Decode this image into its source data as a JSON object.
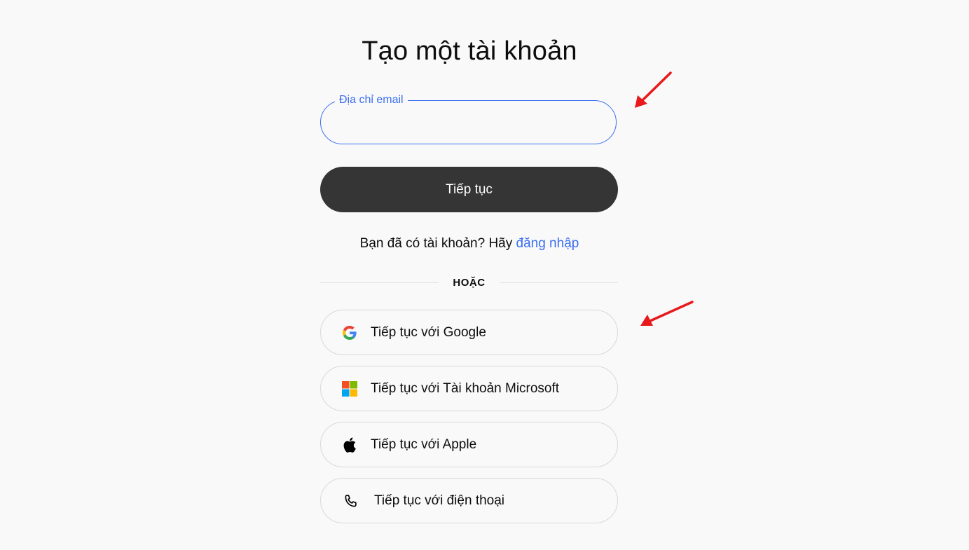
{
  "page": {
    "title": "Tạo một tài khoản"
  },
  "email": {
    "label": "Địa chỉ email",
    "value": ""
  },
  "continue_button": {
    "label": "Tiếp tục"
  },
  "login": {
    "prompt": "Bạn đã có tài khoản? Hãy ",
    "link": "đăng nhập"
  },
  "divider": {
    "text": "HOẶC"
  },
  "social": [
    {
      "label": "Tiếp tục với Google",
      "icon": "google-icon"
    },
    {
      "label": "Tiếp tục với Tài khoản Microsoft",
      "icon": "microsoft-icon"
    },
    {
      "label": "Tiếp tục với Apple",
      "icon": "apple-icon"
    },
    {
      "label": "Tiếp tục với điện thoại",
      "icon": "phone-icon"
    }
  ],
  "colors": {
    "accent": "#3b6ef0",
    "button_dark": "#353535",
    "background": "#f9f9f9",
    "annotation_arrow": "#e8191c"
  }
}
